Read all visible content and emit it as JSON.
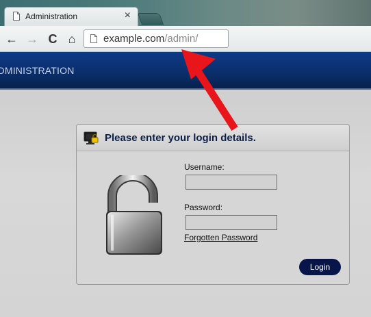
{
  "browser": {
    "tab_title": "Administration",
    "tab_close": "×",
    "url_host": "example.com",
    "url_path": "/admin/",
    "nav": {
      "back": "←",
      "forward": "→",
      "reload": "C",
      "home": "⌂"
    }
  },
  "site": {
    "header_title": "ADMINISTRATION"
  },
  "login": {
    "heading": "Please enter your login details.",
    "username_label": "Username:",
    "username_value": "",
    "password_label": "Password:",
    "password_value": "",
    "forgot_link": "Forgotten Password",
    "submit_label": "Login"
  },
  "annotation": {
    "arrow_color": "#e8151b"
  }
}
